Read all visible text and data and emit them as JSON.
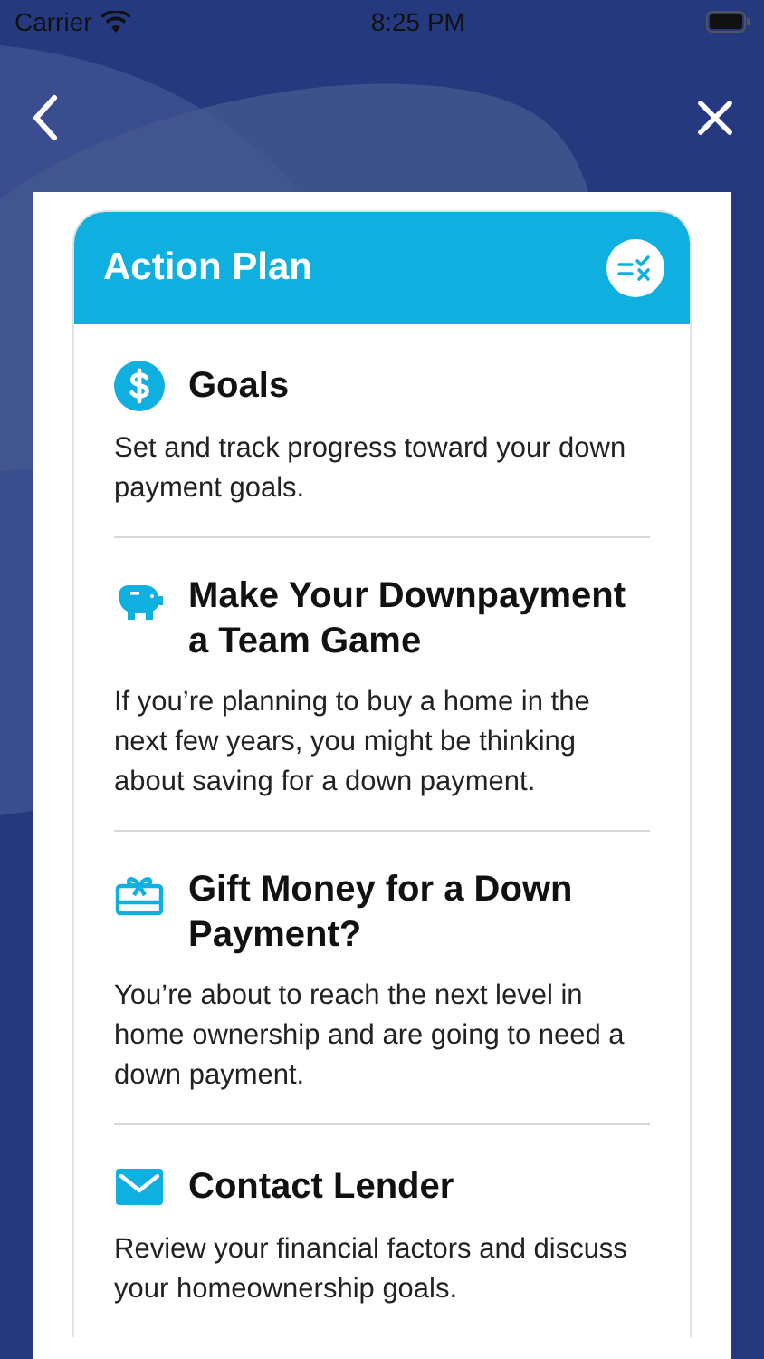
{
  "status_bar": {
    "carrier": "Carrier",
    "time": "8:25 PM"
  },
  "card": {
    "title": "Action Plan"
  },
  "items": [
    {
      "kind": "dollar",
      "title": "Goals",
      "description": "Set and track progress toward your down payment goals."
    },
    {
      "kind": "piggy",
      "title": "Make Your Downpayment a Team Game",
      "description": "If you’re planning to buy a home in the next few years, you might be thinking about saving for a down payment."
    },
    {
      "kind": "gift",
      "title": "Gift Money for a Down Payment?",
      "description": "You’re about to reach the next level in home ownership and are going to need a down payment."
    },
    {
      "kind": "mail",
      "title": "Contact Lender",
      "description": "Review your financial factors and discuss your homeownership goals."
    }
  ]
}
